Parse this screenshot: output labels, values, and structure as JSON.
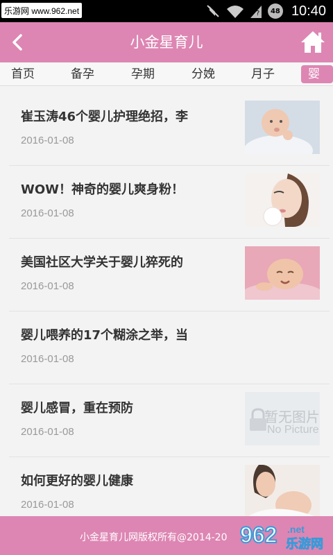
{
  "status_bar": {
    "watermark": "乐游网 www.962.net",
    "battery": "48",
    "time": "10:40"
  },
  "header": {
    "title": "小金星育儿",
    "back_icon": "chevron-left-icon",
    "home_icon": "home-icon",
    "color": "#dd86b3"
  },
  "tabs": [
    {
      "label": "首页"
    },
    {
      "label": "备孕"
    },
    {
      "label": "孕期"
    },
    {
      "label": "分娩"
    },
    {
      "label": "月子"
    },
    {
      "label": "婴儿"
    }
  ],
  "articles": [
    {
      "title": "崔玉涛46个婴儿护理绝招，李",
      "date": "2016-01-08"
    },
    {
      "title": "WOW！神奇的婴儿爽身粉！",
      "date": "2016-01-08"
    },
    {
      "title": "美国社区大学关于婴儿猝死的",
      "date": "2016-01-08"
    },
    {
      "title": "婴儿喂养的17个糊涂之举，当",
      "date": "2016-01-08"
    },
    {
      "title": "婴儿感冒，重在预防",
      "date": "2016-01-08",
      "thumb_text_1": "暂无图片",
      "thumb_text_2": "No Picture"
    },
    {
      "title": "如何更好的婴儿健康",
      "date": "2016-01-08"
    }
  ],
  "footer": {
    "text": "小金星育儿网版权所有@2014-20",
    "watermark_number": "962",
    "watermark_suffix": ".net",
    "watermark_site": "乐游网"
  }
}
